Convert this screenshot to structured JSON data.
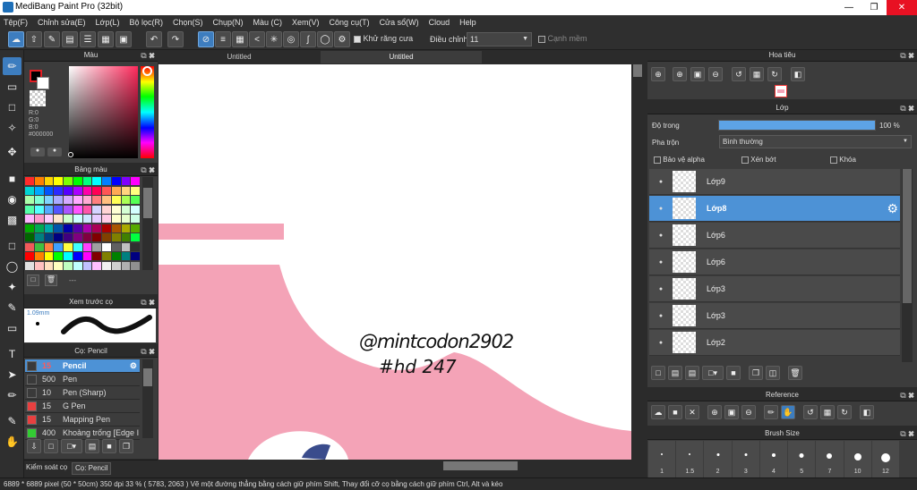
{
  "window": {
    "title": "MediBang Paint Pro (32bit)"
  },
  "menu": [
    "Tệp(F)",
    "Chỉnh sửa(E)",
    "Lớp(L)",
    "Bộ lọc(R)",
    "Chọn(S)",
    "Chụp(N)",
    "Màu (C)",
    "Xem(V)",
    "Công cụ(T)",
    "Cửa sổ(W)",
    "Cloud",
    "Help"
  ],
  "toolbar": {
    "antialias_label": "Khử răng cưa",
    "correction_label": "Điều chỉnh",
    "correction_value": "11",
    "smooth_label": "Cạnh mềm"
  },
  "color_panel": {
    "title": "Màu",
    "r": "R:0",
    "g": "G:0",
    "b": "B:0",
    "hex": "#000000"
  },
  "palette_panel": {
    "title": "Bảng màu",
    "more": "---"
  },
  "preview_panel": {
    "title": "Xem trước cọ",
    "size": "1.09mm"
  },
  "brush_panel": {
    "title": "Cọ: Pencil",
    "items": [
      {
        "size": "15",
        "name": "Pencil",
        "color": "#4d92d6"
      },
      {
        "size": "500",
        "name": "Pen",
        "color": "#3a3a3a"
      },
      {
        "size": "10",
        "name": "Pen (Sharp)",
        "color": "#3a3a3a"
      },
      {
        "size": "15",
        "name": "G Pen",
        "color": "#e84040"
      },
      {
        "size": "15",
        "name": "Mapping Pen",
        "color": "#e84040"
      },
      {
        "size": "400",
        "name": "Khoảng trống [Edge I",
        "color": "#33cc33"
      }
    ],
    "tab_control": "Kiểm soát cọ",
    "tab_brush": "Cọ: Pencil"
  },
  "documents": {
    "tab1": "Untitled",
    "tab2": "Untitled"
  },
  "canvas_text": {
    "line1": "@mintcodon2902",
    "line2": "#hd 247"
  },
  "navigator_panel": {
    "title": "Hoa tiêu"
  },
  "layer_panel": {
    "title": "Lớp",
    "opacity_label": "Độ trong",
    "opacity_value": "100 %",
    "opacity_fraction": 1.0,
    "blend_label": "Pha trộn",
    "blend_value": "Bình thường",
    "protect_alpha": "Bảo vệ alpha",
    "clipping": "Xén bớt",
    "lock": "Khóa",
    "layers": [
      {
        "name": "Lớp9",
        "selected": false
      },
      {
        "name": "Lớp8",
        "selected": true
      },
      {
        "name": "Lớp6",
        "selected": false
      },
      {
        "name": "Lớp6",
        "selected": false
      },
      {
        "name": "Lớp3",
        "selected": false
      },
      {
        "name": "Lớp3",
        "selected": false
      },
      {
        "name": "Lớp2",
        "selected": false
      }
    ]
  },
  "reference_panel": {
    "title": "Reference"
  },
  "brushsize_panel": {
    "title": "Brush Size",
    "sizes": [
      "1",
      "1.5",
      "2",
      "3",
      "4",
      "5",
      "7",
      "10",
      "12"
    ]
  },
  "status": {
    "text": "6889 * 6889 pixel  (50 * 50cm)  350 dpi  33 %  ( 5783, 2063 )  Vẽ một đường thẳng bằng cách giữ phím Shift, Thay đổi cỡ cọ bằng cách giữ phím Ctrl, Alt và kéo"
  },
  "colors": {
    "accent": "#4d92d6",
    "pink": "#f4a3b7",
    "dark_bg": "#2b2b2b"
  }
}
